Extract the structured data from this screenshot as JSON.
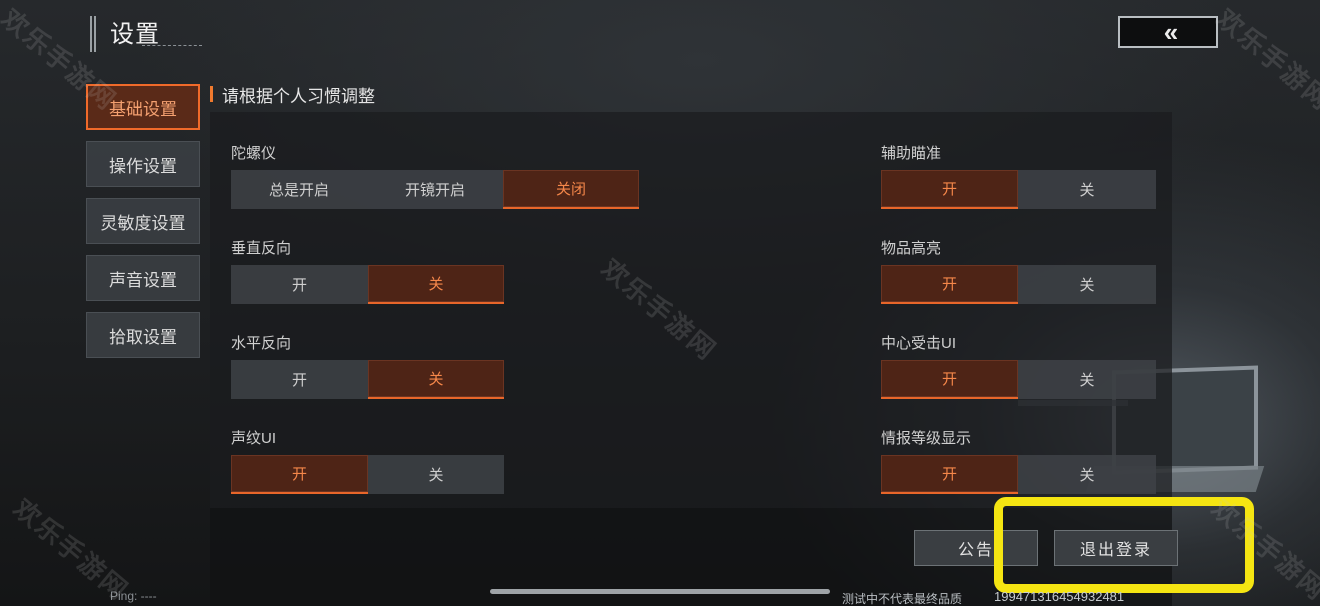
{
  "header": {
    "title": "设置",
    "back_icon": "«"
  },
  "tabs": [
    {
      "label": "基础设置",
      "active": true
    },
    {
      "label": "操作设置",
      "active": false
    },
    {
      "label": "灵敏度设置",
      "active": false
    },
    {
      "label": "声音设置",
      "active": false
    },
    {
      "label": "拾取设置",
      "active": false
    }
  ],
  "subtitle": "请根据个人习惯调整",
  "settings": {
    "gyro": {
      "label": "陀螺仪",
      "options": [
        "总是开启",
        "开镜开启",
        "关闭"
      ],
      "selected": 2
    },
    "vertical_invert": {
      "label": "垂直反向",
      "options": [
        "开",
        "关"
      ],
      "selected": 1
    },
    "horizontal_invert": {
      "label": "水平反向",
      "options": [
        "开",
        "关"
      ],
      "selected": 1
    },
    "voiceprint_ui": {
      "label": "声纹UI",
      "options": [
        "开",
        "关"
      ],
      "selected": 0
    },
    "aim_assist": {
      "label": "辅助瞄准",
      "options": [
        "开",
        "关"
      ],
      "selected": 0
    },
    "item_highlight": {
      "label": "物品高亮",
      "options": [
        "开",
        "关"
      ],
      "selected": 0
    },
    "center_hit_ui": {
      "label": "中心受击UI",
      "options": [
        "开",
        "关"
      ],
      "selected": 0
    },
    "intel_level_display": {
      "label": "情报等级显示",
      "options": [
        "开",
        "关"
      ],
      "selected": 0
    }
  },
  "footer": {
    "notice_label": "公告",
    "logout_label": "退出登录",
    "ping": "Ping: ----",
    "quality_note": "测试中不代表最终品质",
    "user_id": "199471316454932481"
  },
  "watermark": "欢乐手游网",
  "colors": {
    "accent": "#f07a2e",
    "selected_bg": "#4e2416",
    "highlight": "#f5e512"
  }
}
